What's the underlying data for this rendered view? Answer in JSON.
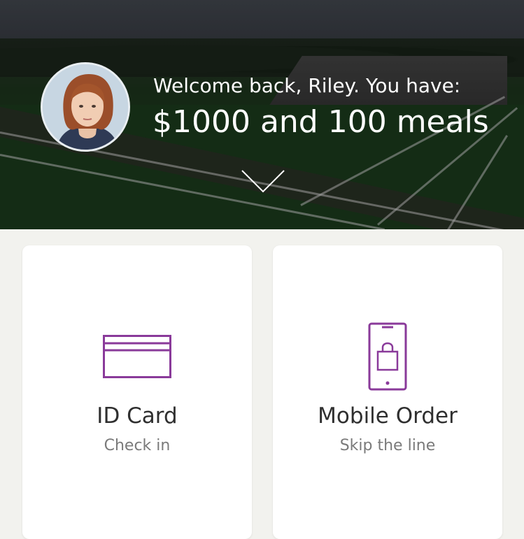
{
  "header": {
    "welcome_text": "Welcome back, Riley. You have:",
    "balance_text": "$1000 and 100 meals",
    "avatar_icon": "user-avatar-photo",
    "expand_icon": "chevron-down-icon"
  },
  "cards": [
    {
      "title": "ID Card",
      "subtitle": "Check in",
      "icon": "id-card-icon"
    },
    {
      "title": "Mobile Order",
      "subtitle": "Skip the line",
      "icon": "mobile-shopping-bag-icon"
    }
  ],
  "colors": {
    "accent": "#8a3a9a",
    "card_background": "#ffffff",
    "page_background": "#f2f2ee"
  }
}
